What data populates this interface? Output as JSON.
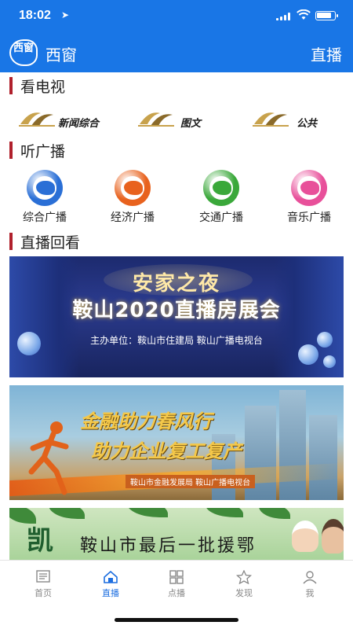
{
  "status": {
    "time": "18:02",
    "battery_level": 0.85
  },
  "header": {
    "app_title": "西窗",
    "right_link": "直播",
    "logo_text": "西窗"
  },
  "sections": {
    "tv": {
      "title": "看电视",
      "channels": [
        {
          "label": "新闻综合"
        },
        {
          "label": "图文"
        },
        {
          "label": "公共"
        }
      ]
    },
    "radio": {
      "title": "听广播",
      "stations": [
        {
          "label": "综合广播",
          "color": "#2a6fd6"
        },
        {
          "label": "经济广播",
          "color": "#e8621e"
        },
        {
          "label": "交通广播",
          "color": "#3aa83a"
        },
        {
          "label": "音乐广播",
          "color": "#e8509a"
        }
      ]
    },
    "replay": {
      "title": "直播回看"
    }
  },
  "banners": [
    {
      "title": "安家之夜",
      "subtitle": "鞍山2020直播房展会",
      "org": "主办单位：鞍山市住建局 鞍山广播电视台"
    },
    {
      "line1": "金融助力春风行",
      "line2": "助力企业复工复产",
      "org": "鞍山市金融发展局   鞍山广播电视台"
    },
    {
      "big_char": "凯",
      "text": "鞍山市最后一批援鄂"
    }
  ],
  "tabs": [
    {
      "label": "首页",
      "icon": "home-doc-icon",
      "active": false
    },
    {
      "label": "直播",
      "icon": "house-icon",
      "active": true
    },
    {
      "label": "点播",
      "icon": "grid-icon",
      "active": false
    },
    {
      "label": "发现",
      "icon": "star-icon",
      "active": false
    },
    {
      "label": "我",
      "icon": "user-icon",
      "active": false
    }
  ],
  "colors": {
    "primary": "#1976e6",
    "section_bar": "#b0202c",
    "active_tab": "#1e6fe0"
  }
}
